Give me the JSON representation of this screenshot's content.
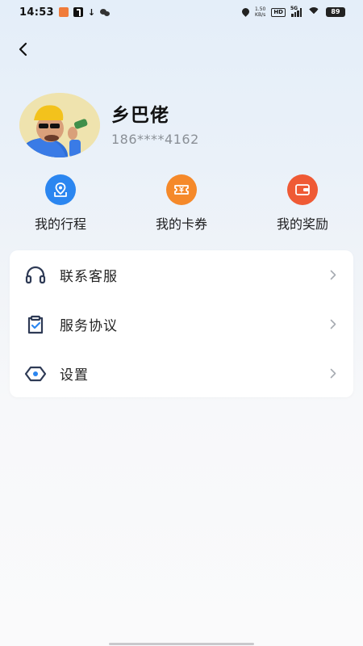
{
  "status_bar": {
    "time": "14:53",
    "net_speed_value": "1.50",
    "net_speed_unit": "KB/s",
    "hd_label": "HD",
    "signal_label": "5G",
    "battery": "89"
  },
  "profile": {
    "name": "乡巴佬",
    "phone": "186****4162"
  },
  "quick_actions": [
    {
      "label": "我的行程",
      "icon": "map-pin-icon",
      "color": "#2b86f0"
    },
    {
      "label": "我的卡券",
      "icon": "ticket-icon",
      "color": "#f5892a"
    },
    {
      "label": "我的奖励",
      "icon": "wallet-icon",
      "color": "#ef5a35"
    }
  ],
  "menu": [
    {
      "label": "联系客服",
      "icon": "headset-icon"
    },
    {
      "label": "服务协议",
      "icon": "clipboard-check-icon"
    },
    {
      "label": "设置",
      "icon": "settings-eye-icon"
    }
  ],
  "colors": {
    "accent_blue": "#2b86f0",
    "accent_orange": "#f5892a",
    "accent_red": "#ef5a35",
    "icon_navy": "#2e3a55"
  }
}
